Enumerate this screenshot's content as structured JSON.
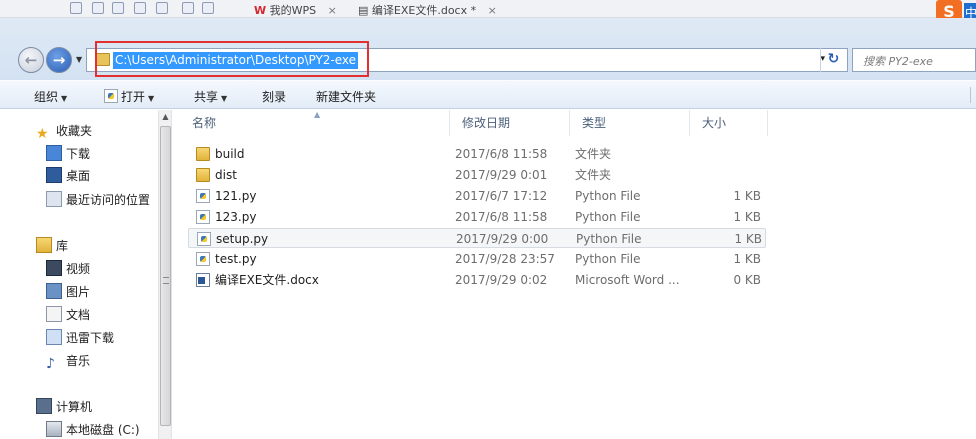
{
  "topstrip": {
    "tabs": [
      {
        "label": "我的WPS",
        "close": "×"
      },
      {
        "label": "编译EXE文件.docx *",
        "close": "×"
      }
    ]
  },
  "address": {
    "path": "C:\\Users\\Administrator\\Desktop\\PY2-exe",
    "refresh_icon": "refresh-icon",
    "dropdown": "▾"
  },
  "search": {
    "placeholder": "搜索 PY2-exe"
  },
  "toolbar": {
    "organize": "组织",
    "open": "打开",
    "share": "共享",
    "burn": "刻录",
    "new_folder": "新建文件夹"
  },
  "nav": {
    "favorites_header": "收藏夹",
    "favorites": [
      "下载",
      "桌面",
      "最近访问的位置"
    ],
    "libraries_header": "库",
    "libraries": [
      "视频",
      "图片",
      "文档",
      "迅雷下载",
      "音乐"
    ],
    "computer_header": "计算机",
    "drives": [
      "本地磁盘 (C:)"
    ]
  },
  "columns": {
    "name": "名称",
    "date": "修改日期",
    "type": "类型",
    "size": "大小"
  },
  "files": [
    {
      "name": "build",
      "date": "2017/6/8 11:58",
      "type": "文件夹",
      "size": "",
      "icon": "folder"
    },
    {
      "name": "dist",
      "date": "2017/9/29 0:01",
      "type": "文件夹",
      "size": "",
      "icon": "folder"
    },
    {
      "name": "121.py",
      "date": "2017/6/7 17:12",
      "type": "Python File",
      "size": "1 KB",
      "icon": "python"
    },
    {
      "name": "123.py",
      "date": "2017/6/8 11:58",
      "type": "Python File",
      "size": "1 KB",
      "icon": "python"
    },
    {
      "name": "setup.py",
      "date": "2017/9/29 0:00",
      "type": "Python File",
      "size": "1 KB",
      "icon": "python"
    },
    {
      "name": "test.py",
      "date": "2017/9/28 23:57",
      "type": "Python File",
      "size": "1 KB",
      "icon": "python"
    },
    {
      "name": "编译EXE文件.docx",
      "date": "2017/9/29 0:02",
      "type": "Microsoft Word ...",
      "size": "0 KB",
      "icon": "word"
    }
  ],
  "colors": {
    "selection": "#3399ff",
    "highlight_box": "#e23030"
  }
}
